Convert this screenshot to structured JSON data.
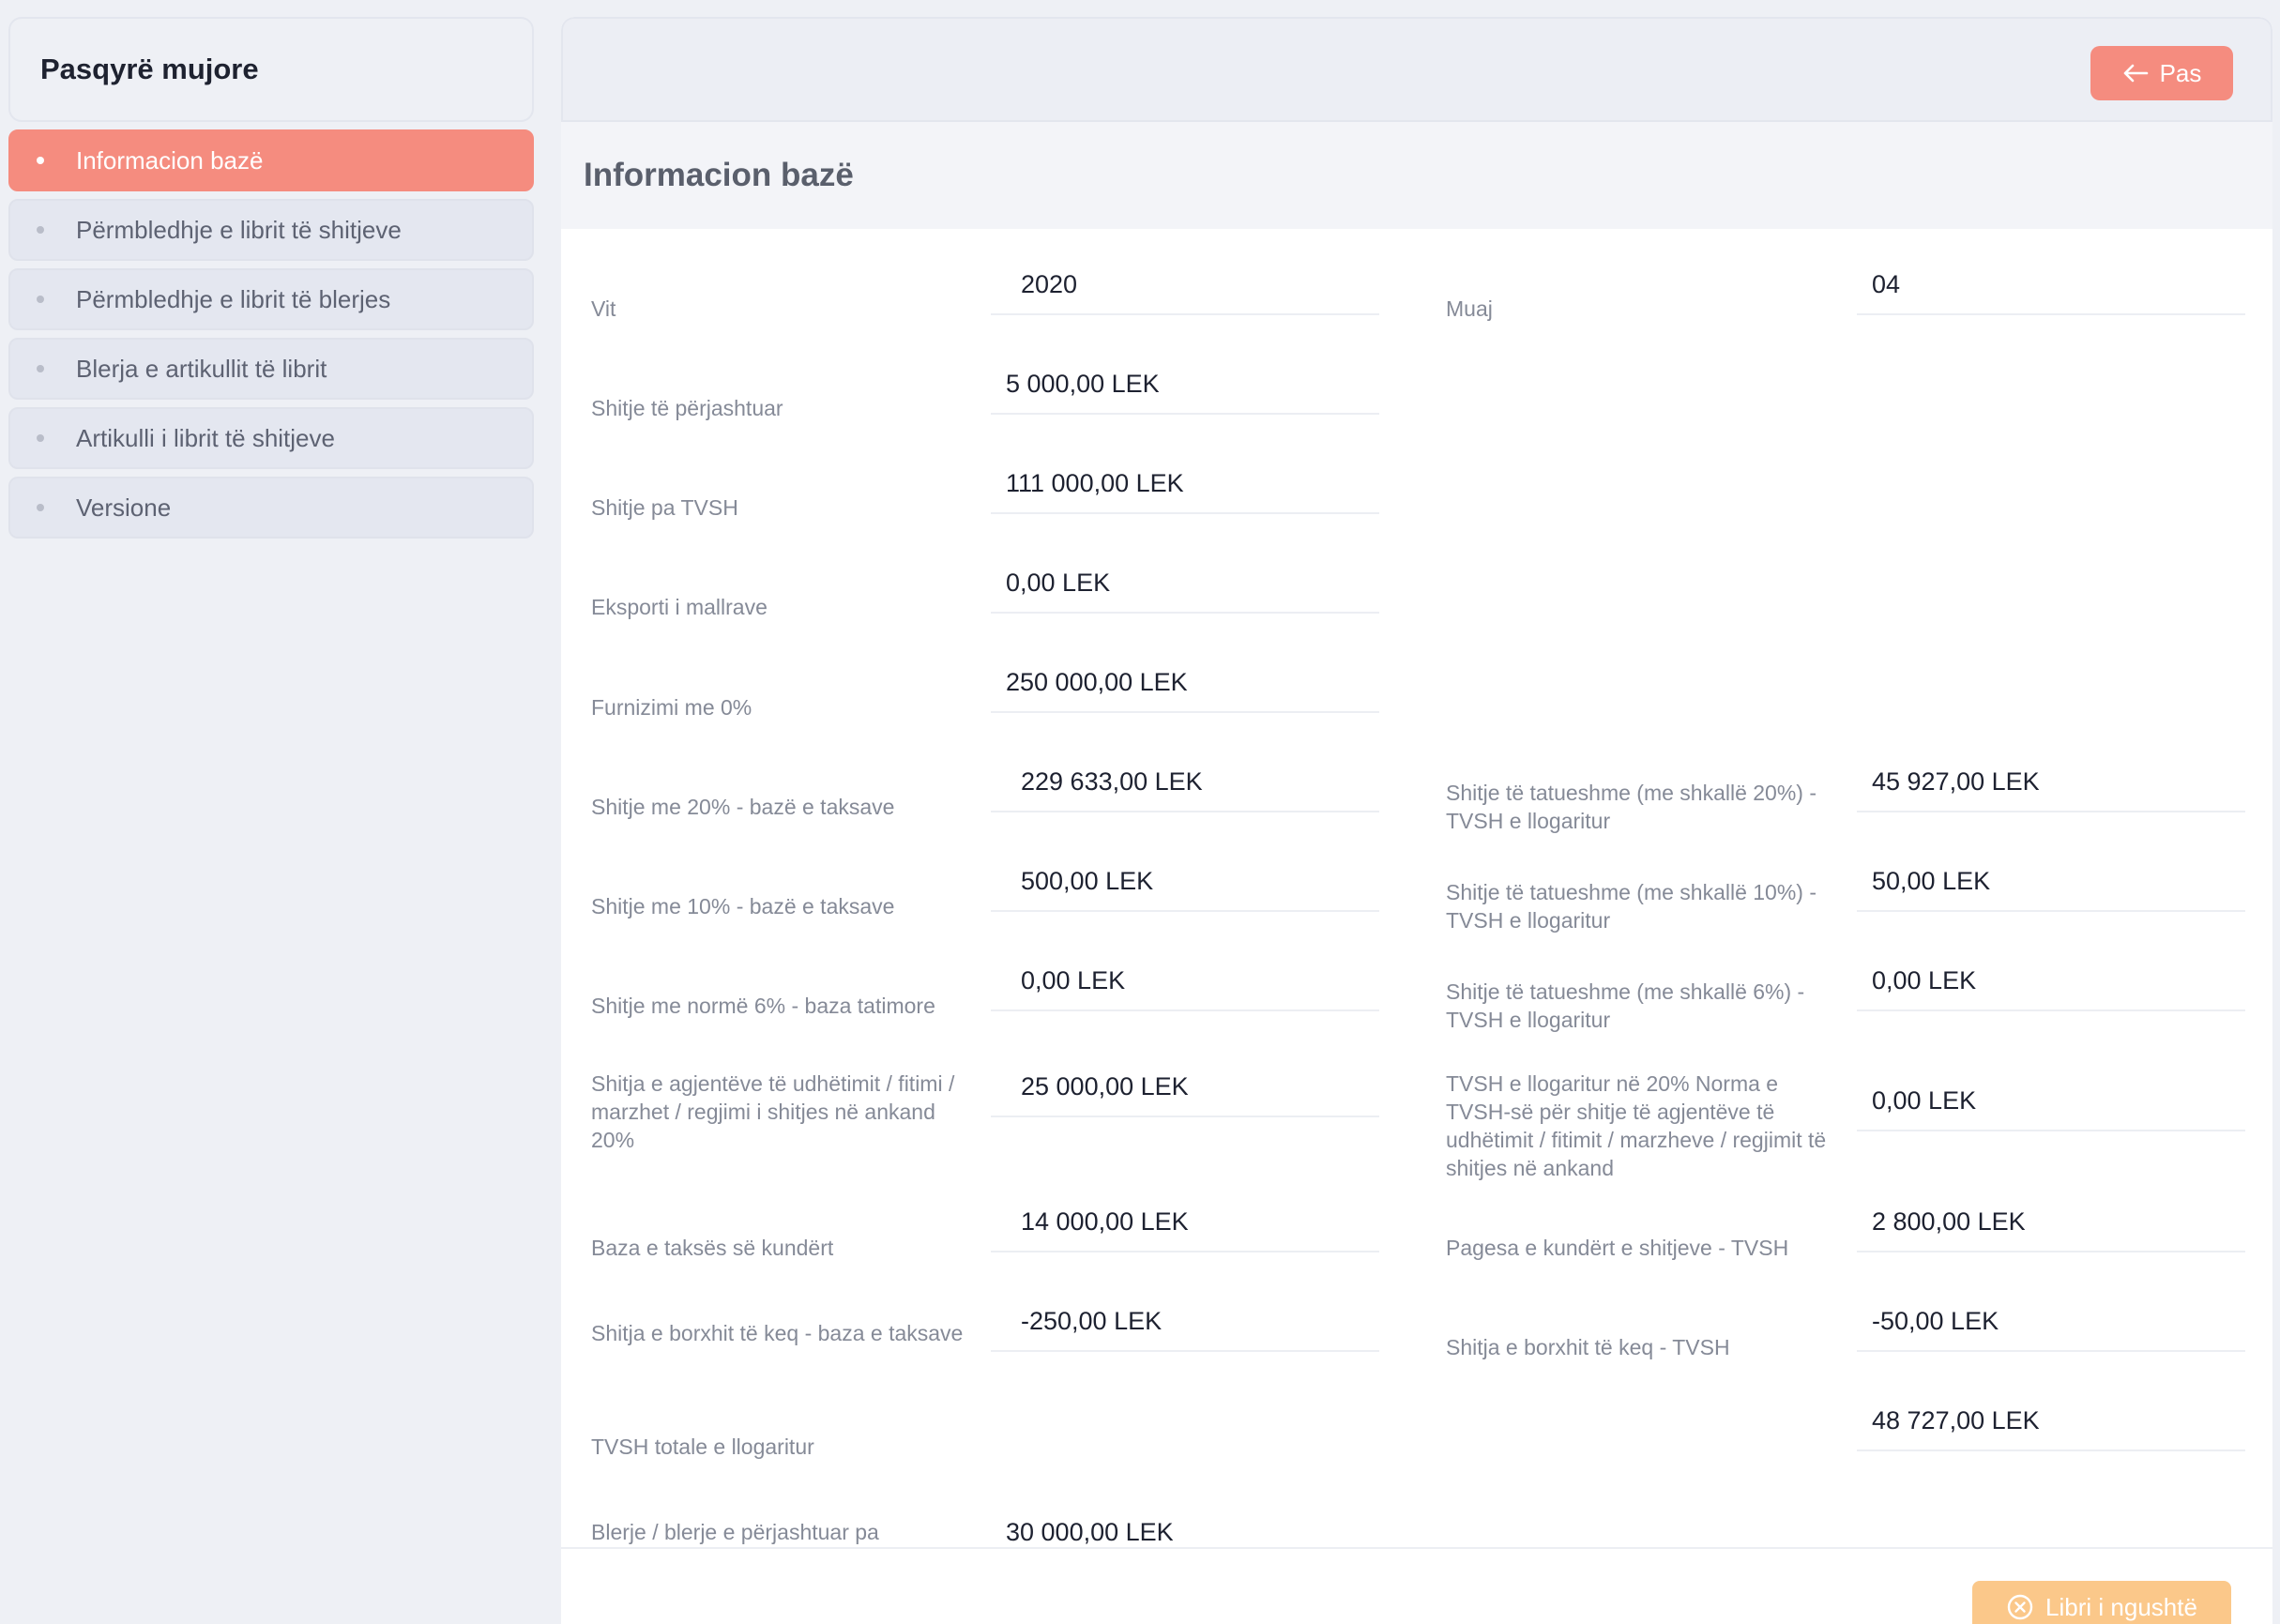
{
  "sidebar": {
    "title": "Pasqyrë mujore",
    "items": [
      {
        "label": "Informacion bazë",
        "active": true
      },
      {
        "label": "Përmbledhje e librit të shitjeve",
        "active": false
      },
      {
        "label": "Përmbledhje e librit të blerjes",
        "active": false
      },
      {
        "label": "Blerja e artikullit të librit",
        "active": false
      },
      {
        "label": "Artikulli i librit të shitjeve",
        "active": false
      },
      {
        "label": "Versione",
        "active": false
      }
    ]
  },
  "header": {
    "back_label": "Pas",
    "back_icon": "arrow-left-icon"
  },
  "section": {
    "title": "Informacion bazë"
  },
  "form": {
    "year_label": "Vit",
    "year_value": "2020",
    "month_label": "Muaj",
    "month_value": "04",
    "exempt_sales_label": "Shitje të përjashtuar",
    "exempt_sales_value": "5 000,00 LEK",
    "sales_no_vat_label": "Shitje pa TVSH",
    "sales_no_vat_value": "111 000,00 LEK",
    "export_goods_label": "Eksporti i mallrave",
    "export_goods_value": "0,00 LEK",
    "supply_zero_label": "Furnizimi me 0%",
    "supply_zero_value": "250 000,00 LEK",
    "sales20_base_label": "Shitje me 20% - bazë e taksave",
    "sales20_base_value": "229 633,00 LEK",
    "sales20_vat_label": "Shitje të tatueshme (me shkallë 20%) - TVSH e llogaritur",
    "sales20_vat_value": "45 927,00 LEK",
    "sales10_base_label": "Shitje me 10% - bazë e taksave",
    "sales10_base_value": "500,00 LEK",
    "sales10_vat_label": "Shitje të tatueshme (me shkallë 10%) - TVSH e llogaritur",
    "sales10_vat_value": "50,00 LEK",
    "sales6_base_label": "Shitje me normë 6% - baza tatimore",
    "sales6_base_value": "0,00 LEK",
    "sales6_vat_label": "Shitje të tatueshme (me shkallë 6%) - TVSH e llogaritur",
    "sales6_vat_value": "0,00 LEK",
    "agents_base_label": "Shitja e agjentëve të udhëtimit / fitimi / marzhet / regjimi i shitjes në ankand 20%",
    "agents_base_value": "25 000,00 LEK",
    "agents_vat_label": "TVSH e llogaritur në 20% Norma e TVSH-së për shitje të agjentëve të udhëtimit / fitimit / marzheve / regjimit të shitjes në ankand",
    "agents_vat_value": "0,00 LEK",
    "reverse_base_label": "Baza e taksës së kundërt",
    "reverse_base_value": "14 000,00 LEK",
    "reverse_vat_label": "Pagesa e kundërt e shitjeve - TVSH",
    "reverse_vat_value": "2 800,00 LEK",
    "baddebt_base_label": "Shitja e borxhit të keq - baza e taksave",
    "baddebt_base_value": "-250,00 LEK",
    "baddebt_vat_label": "Shitja e borxhit të keq - TVSH",
    "baddebt_vat_value": "-50,00 LEK",
    "total_vat_label": "TVSH totale e llogaritur",
    "total_vat_value": "48 727,00 LEK",
    "purchases_exempt_label": "Blerje / blerje e përjashtuar pa",
    "purchases_exempt_value": "30 000,00 LEK"
  },
  "footer": {
    "broken_book_label": "Libri i ngushtë",
    "broken_book_icon": "close-circle-icon"
  },
  "colors": {
    "accent": "#f58c7f",
    "warning": "#fbc88a",
    "background": "#eef0f5"
  }
}
